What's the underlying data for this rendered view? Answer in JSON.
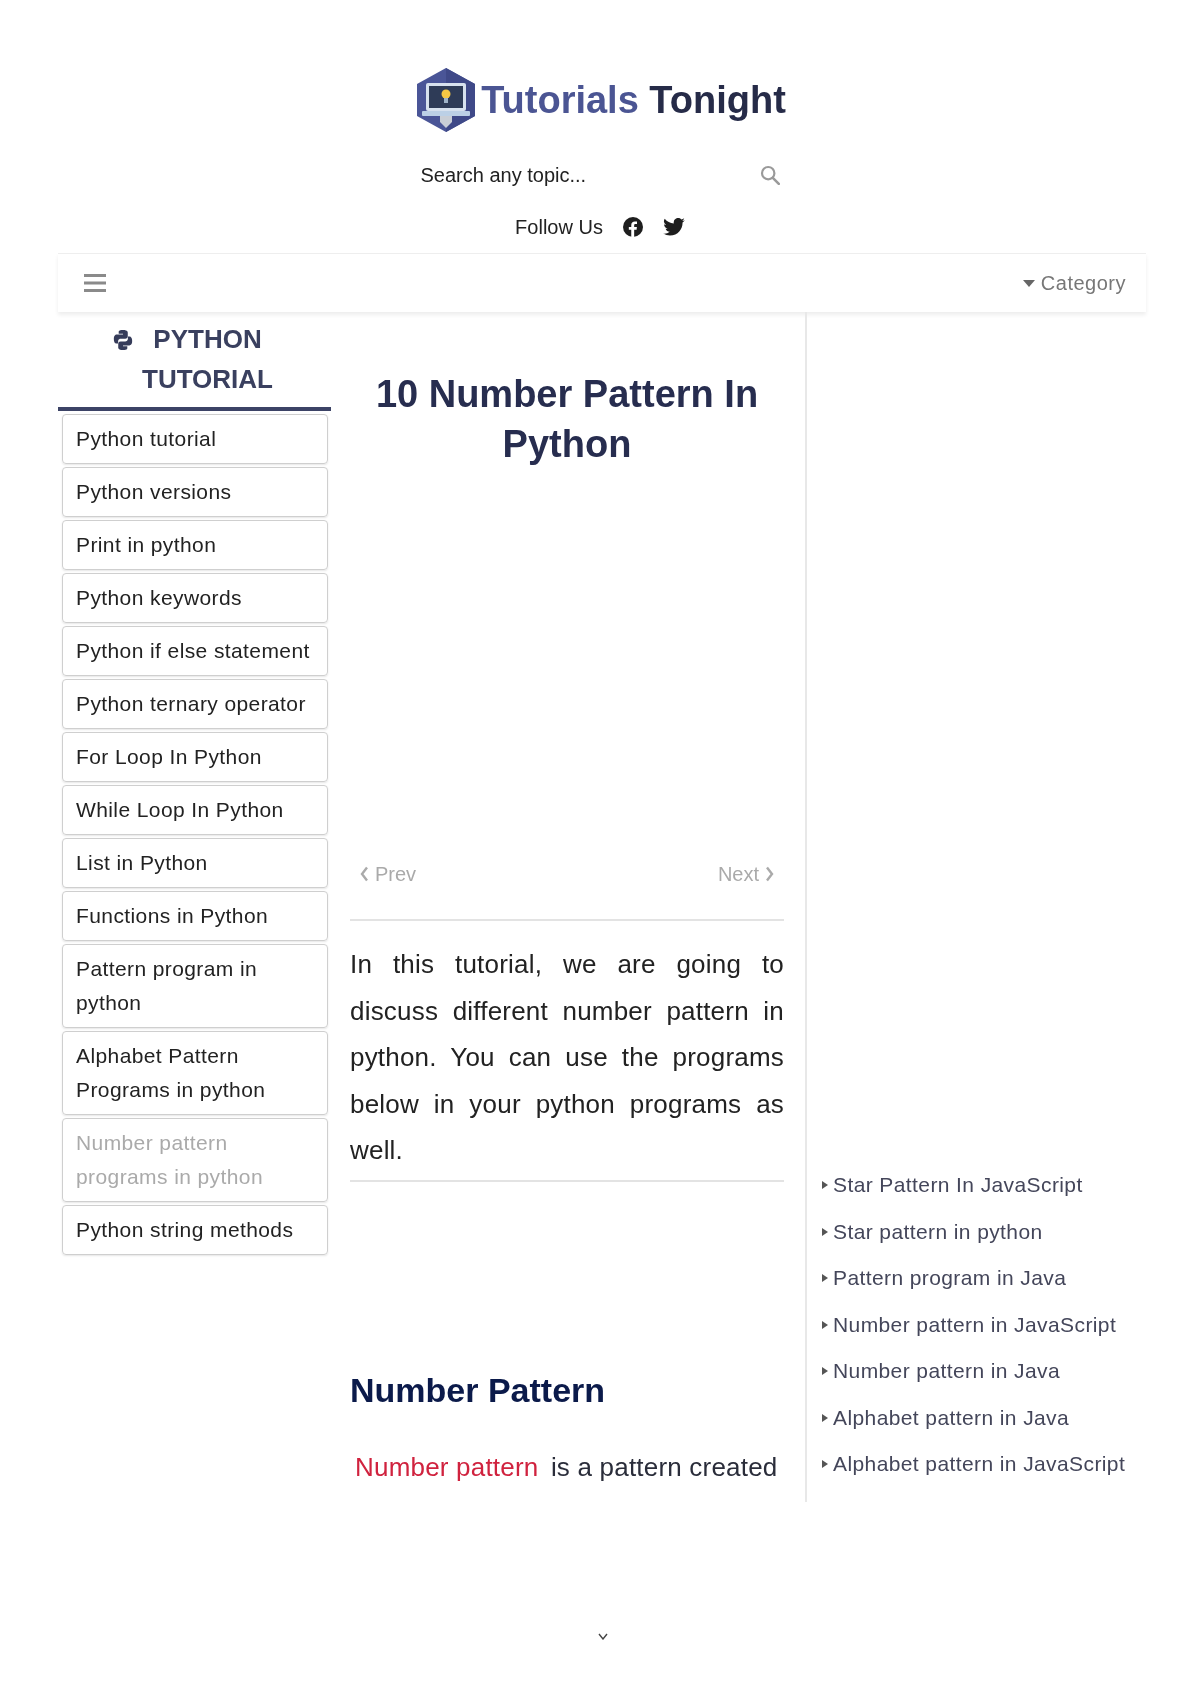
{
  "header": {
    "logo": {
      "parts": [
        "Tutorials",
        "Tonight"
      ]
    },
    "search": {
      "placeholder": "Search any topic..."
    },
    "follow": {
      "label": "Follow Us"
    }
  },
  "navbar": {
    "category": "Category"
  },
  "sidebar": {
    "title": "PYTHON TUTORIAL",
    "items": [
      {
        "label": "Python tutorial",
        "selected": false
      },
      {
        "label": "Python versions",
        "selected": false
      },
      {
        "label": "Print in python",
        "selected": false
      },
      {
        "label": "Python keywords",
        "selected": false
      },
      {
        "label": "Python if else statement",
        "selected": false
      },
      {
        "label": "Python ternary operator",
        "selected": false
      },
      {
        "label": "For Loop In Python",
        "selected": false
      },
      {
        "label": "While Loop In Python",
        "selected": false
      },
      {
        "label": "List in Python",
        "selected": false
      },
      {
        "label": "Functions in Python",
        "selected": false
      },
      {
        "label": "Pattern program in python",
        "selected": false
      },
      {
        "label": "Alphabet Pattern Programs in python",
        "selected": false
      },
      {
        "label": "Number pattern programs in python",
        "selected": true
      },
      {
        "label": "Python string methods",
        "selected": false
      }
    ]
  },
  "article": {
    "title": "10 Number Pattern In Python",
    "pager": {
      "prev": "Prev",
      "next": "Next"
    },
    "intro": "In this tutorial, we are going to discuss different number pattern in python. You can use the programs below in your python programs as well.",
    "section": {
      "heading": "Number Pattern",
      "term": "Number pattern",
      "text": "is a pattern created"
    }
  },
  "related": {
    "items": [
      "Star Pattern In JavaScript",
      "Star pattern in python",
      "Pattern program in Java",
      "Number pattern in JavaScript",
      "Number pattern in Java",
      "Alphabet pattern in Java",
      "Alphabet pattern in JavaScript"
    ]
  }
}
